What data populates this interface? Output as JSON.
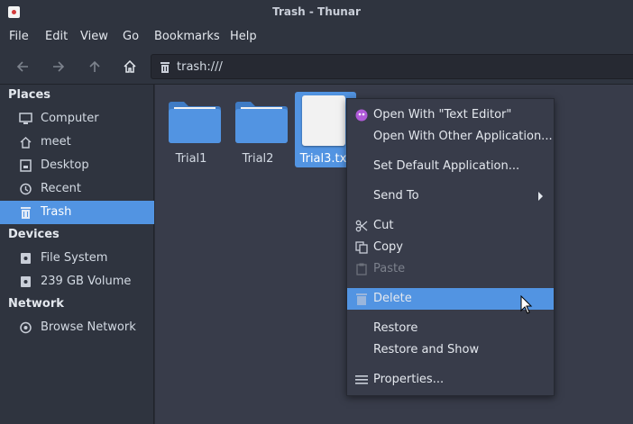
{
  "window": {
    "title": "Trash - Thunar"
  },
  "menubar": {
    "items": [
      "File",
      "Edit",
      "View",
      "Go",
      "Bookmarks",
      "Help"
    ]
  },
  "toolbar": {
    "location": "trash:///"
  },
  "sidebar": {
    "places_heading": "Places",
    "places": [
      {
        "label": "Computer",
        "icon": "computer-icon"
      },
      {
        "label": "meet",
        "icon": "home-icon"
      },
      {
        "label": "Desktop",
        "icon": "desktop-icon"
      },
      {
        "label": "Recent",
        "icon": "clock-icon"
      },
      {
        "label": "Trash",
        "icon": "trash-icon",
        "selected": true
      }
    ],
    "devices_heading": "Devices",
    "devices": [
      {
        "label": "File System",
        "icon": "drive-icon"
      },
      {
        "label": "239 GB Volume",
        "icon": "drive-icon"
      }
    ],
    "network_heading": "Network",
    "network": [
      {
        "label": "Browse Network",
        "icon": "network-icon"
      }
    ]
  },
  "files": [
    {
      "name": "Trial1",
      "type": "folder"
    },
    {
      "name": "Trial2",
      "type": "folder"
    },
    {
      "name": "Trial3.txt",
      "type": "text",
      "selected": true
    }
  ],
  "context_menu": {
    "items": [
      {
        "label": "Open With \"Text Editor\"",
        "icon": "text-editor-icon"
      },
      {
        "label": "Open With Other Application..."
      },
      {
        "label": "Set Default Application..."
      },
      {
        "label": "Send To",
        "submenu": true
      },
      {
        "label": "Cut",
        "icon": "scissors-icon"
      },
      {
        "label": "Copy",
        "icon": "copy-icon"
      },
      {
        "label": "Paste",
        "icon": "paste-icon",
        "disabled": true
      },
      {
        "label": "Delete",
        "icon": "trash-icon",
        "highlighted": true
      },
      {
        "label": "Restore"
      },
      {
        "label": "Restore and Show"
      },
      {
        "label": "Properties...",
        "icon": "properties-icon"
      }
    ]
  },
  "colors": {
    "accent": "#5294e2",
    "window_bg": "#2f343f",
    "view_bg": "#383c4a",
    "folder": "#5294e2"
  }
}
